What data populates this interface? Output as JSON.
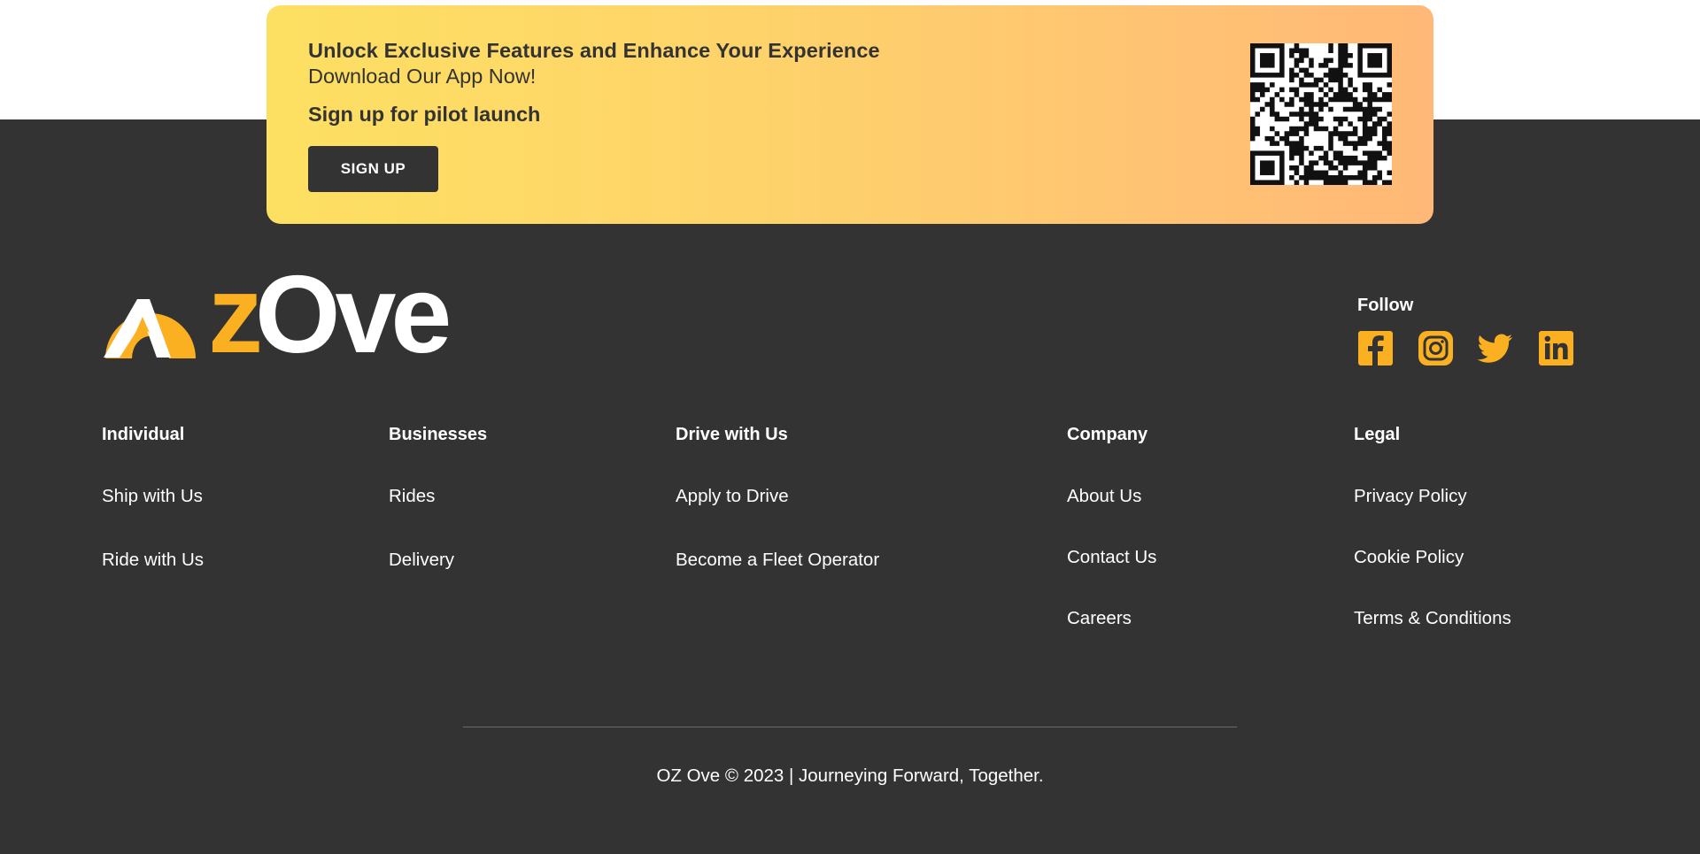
{
  "promo": {
    "headline": "Unlock Exclusive Features and Enhance Your Experience",
    "subheadline": "Download Our App Now!",
    "pilot_text": "Sign up for pilot launch",
    "signup_label": "SIGN UP",
    "gradient_start": "#fde062",
    "gradient_end": "#ffb877"
  },
  "brand": {
    "logo_part1": "Oz",
    "logo_part2": "Ove",
    "accent_color": "#fbb021",
    "footer_bg": "#333333"
  },
  "follow": {
    "title": "Follow",
    "icons": [
      "facebook-icon",
      "instagram-icon",
      "twitter-icon",
      "linkedin-icon"
    ]
  },
  "columns": [
    {
      "title": "Individual",
      "links": [
        "Ship with Us",
        "Ride with Us"
      ]
    },
    {
      "title": "Businesses",
      "links": [
        "Rides",
        "Delivery"
      ]
    },
    {
      "title": "Drive with Us",
      "links": [
        "Apply to Drive",
        "Become a Fleet Operator"
      ]
    },
    {
      "title": "Company",
      "links": [
        "About Us",
        "Contact Us",
        "Careers"
      ]
    },
    {
      "title": "Legal",
      "links": [
        "Privacy Policy",
        "Cookie Policy",
        "Terms & Conditions"
      ]
    }
  ],
  "footer": {
    "copyright": "OZ Ove © 2023 | Journeying Forward, Together."
  }
}
